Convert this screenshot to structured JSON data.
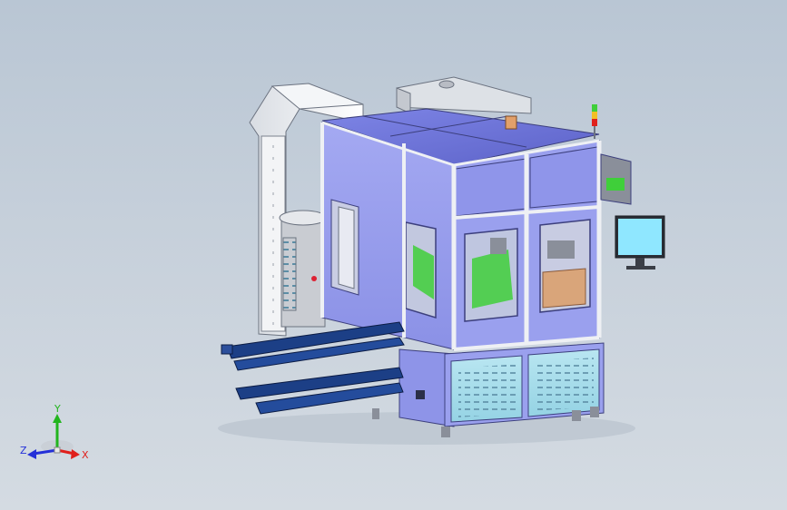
{
  "viewport": {
    "background_top": "#b9c6d4",
    "background_bottom": "#d4dbe2"
  },
  "triad": {
    "x_label": "X",
    "y_label": "Y",
    "z_label": "Z",
    "x_color": "#e0201c",
    "y_color": "#22b51e",
    "z_color": "#2430d8"
  },
  "colors": {
    "panel_blue": "#8f95ea",
    "panel_blue_dark": "#6b70c9",
    "frame_white": "#eef0f4",
    "frame_grey": "#8a8f9a",
    "base_cyan": "#a9ddeb",
    "rail_blue": "#1c3f86",
    "monitor_screen": "#8fe7ff",
    "green_parts": "#3fcf3a",
    "wood_parts": "#d9a57a"
  }
}
